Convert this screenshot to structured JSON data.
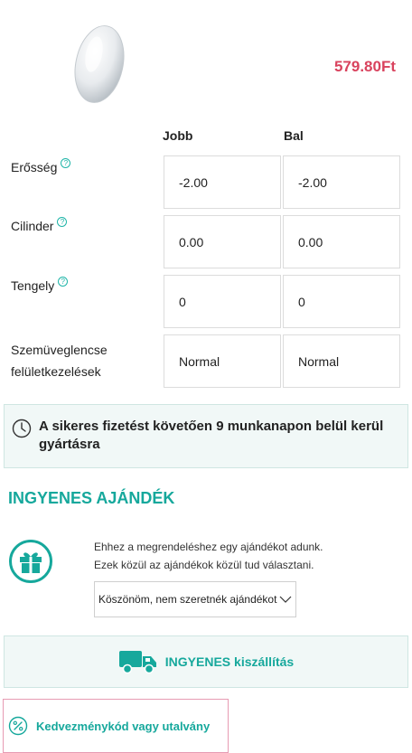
{
  "product": {
    "price": "579.80Ft"
  },
  "prescription": {
    "columns": {
      "right": "Jobb",
      "left": "Bal"
    },
    "rows": [
      {
        "label": "Erősség",
        "right": "-2.00",
        "left": "-2.00"
      },
      {
        "label": "Cilinder",
        "right": "0.00",
        "left": "0.00"
      },
      {
        "label": "Tengely",
        "right": "0",
        "left": "0"
      },
      {
        "label_line1": "Szemüveglencse",
        "label_line2": "felületkezelések",
        "right": "Normal",
        "left": "Normal"
      }
    ],
    "help_glyph": "?"
  },
  "notice": {
    "text": "A sikeres fizetést követően 9 munkanapon belül kerül gyártásra",
    "icon": "clock-icon"
  },
  "gift": {
    "title": "INGYENES AJÁNDÉK",
    "line1": "Ehhez a megrendeléshez egy ajándékot adunk.",
    "line2": "Ezek közül az ajándékok közül tud választani.",
    "selected": "Köszönöm, nem szeretnék ajándékot",
    "icon": "gift-icon"
  },
  "shipping": {
    "label": "INGYENES kiszállítás",
    "icon": "truck-icon"
  },
  "coupon": {
    "label": "Kedvezménykód vagy utalvány",
    "icon": "percent-icon"
  },
  "colors": {
    "accent": "#16a89c",
    "price": "#d9435e",
    "coupon_border": "#e79bb3",
    "panel_bg": "#f1f8f7"
  }
}
